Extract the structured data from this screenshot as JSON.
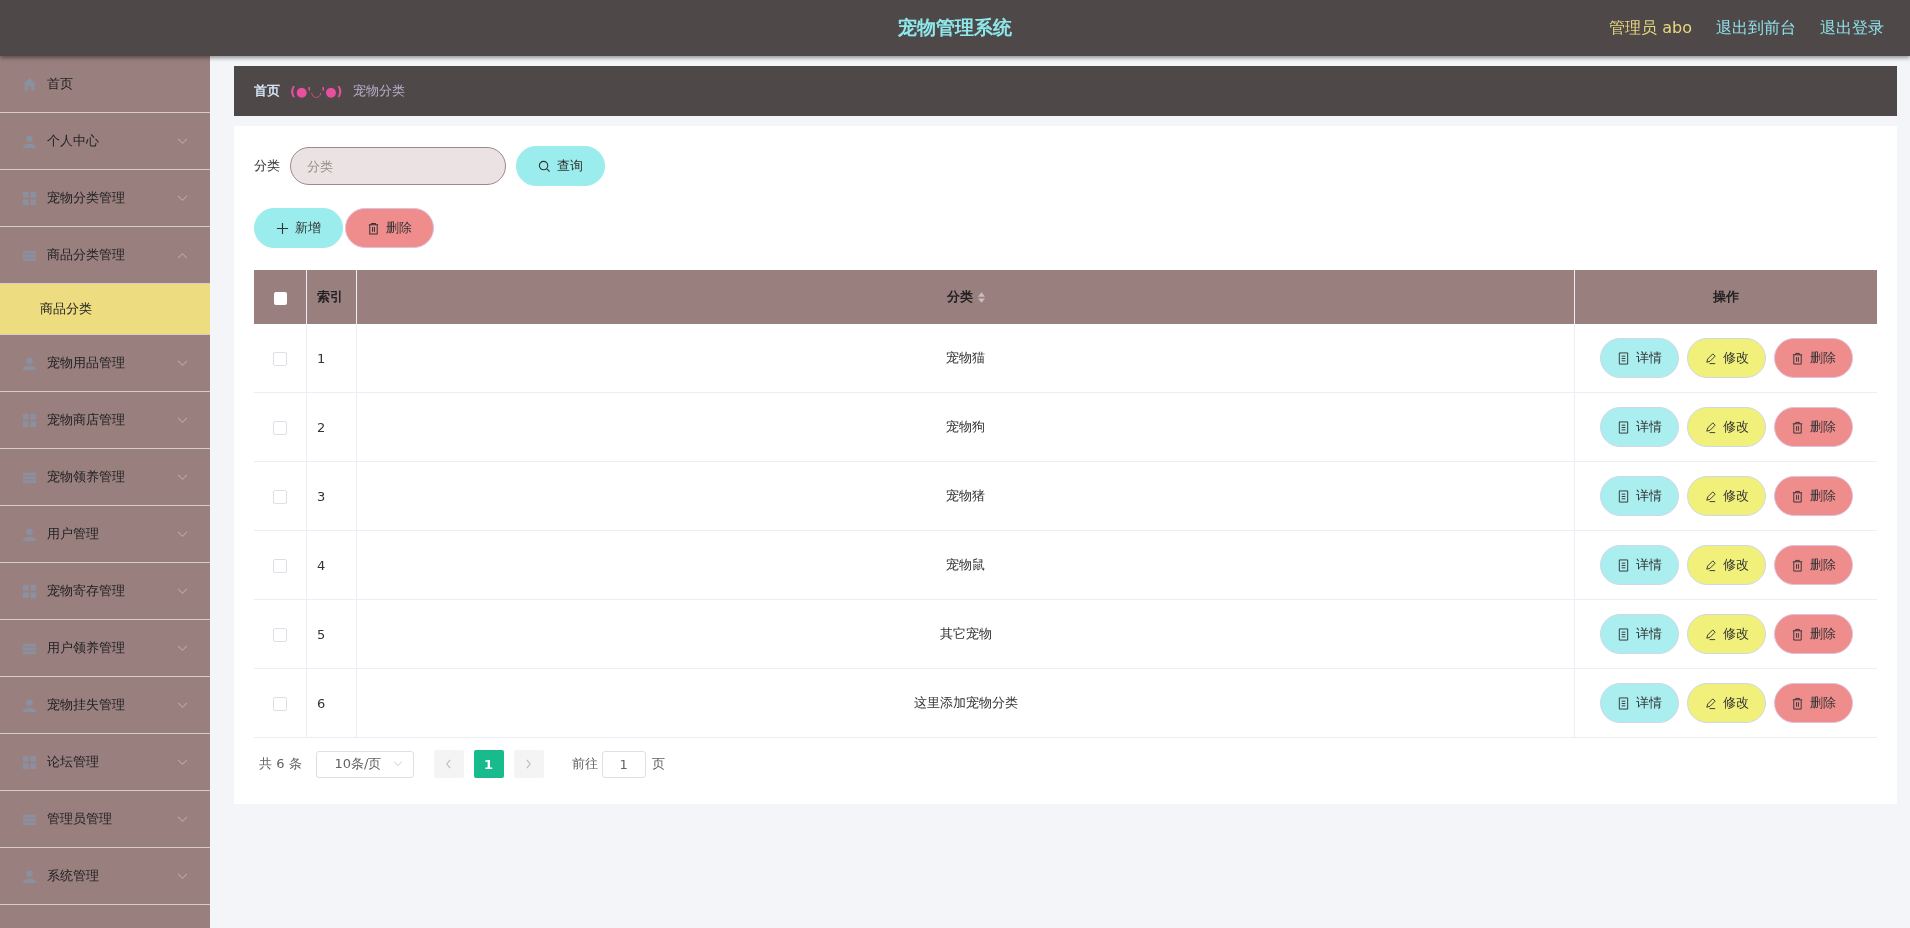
{
  "header": {
    "title": "宠物管理系统",
    "user": "管理员 abo",
    "links": [
      "退出到前台",
      "退出登录"
    ]
  },
  "sidebar": {
    "items": [
      {
        "label": "首页",
        "kind": "link"
      },
      {
        "label": "个人中心",
        "kind": "menu",
        "expanded": false
      },
      {
        "label": "宠物分类管理",
        "kind": "menu",
        "expanded": false
      },
      {
        "label": "商品分类管理",
        "kind": "menu",
        "expanded": true,
        "children": [
          {
            "label": "商品分类",
            "selected": true
          }
        ]
      },
      {
        "label": "宠物用品管理",
        "kind": "menu",
        "expanded": false
      },
      {
        "label": "宠物商店管理",
        "kind": "menu",
        "expanded": false
      },
      {
        "label": "宠物领养管理",
        "kind": "menu",
        "expanded": false
      },
      {
        "label": "用户管理",
        "kind": "menu",
        "expanded": false
      },
      {
        "label": "宠物寄存管理",
        "kind": "menu",
        "expanded": false
      },
      {
        "label": "用户领养管理",
        "kind": "menu",
        "expanded": false
      },
      {
        "label": "宠物挂失管理",
        "kind": "menu",
        "expanded": false
      },
      {
        "label": "论坛管理",
        "kind": "menu",
        "expanded": false
      },
      {
        "label": "管理员管理",
        "kind": "menu",
        "expanded": false
      },
      {
        "label": "系统管理",
        "kind": "menu",
        "expanded": false
      }
    ]
  },
  "breadcrumb": {
    "home": "首页",
    "separator": "(●'◡'●)",
    "current": "宠物分类"
  },
  "search": {
    "label": "分类",
    "placeholder": "分类",
    "button": "查询"
  },
  "toolbar": [
    {
      "label": "新增",
      "kind": "add"
    },
    {
      "label": "删除",
      "kind": "delete"
    }
  ],
  "table": {
    "all_checked": false,
    "columns": [
      {
        "label": "索引",
        "sortable": false
      },
      {
        "label": "分类",
        "sortable": true
      },
      {
        "label": "操作",
        "sortable": false
      }
    ],
    "rows": [
      {
        "checked": false,
        "index": "1",
        "category": "宠物猫",
        "actions": [
          {
            "label": "详情",
            "kind": "detail"
          },
          {
            "label": "修改",
            "kind": "edit"
          },
          {
            "label": "删除",
            "kind": "delete"
          }
        ]
      },
      {
        "checked": false,
        "index": "2",
        "category": "宠物狗",
        "actions": [
          {
            "label": "详情",
            "kind": "detail"
          },
          {
            "label": "修改",
            "kind": "edit"
          },
          {
            "label": "删除",
            "kind": "delete"
          }
        ]
      },
      {
        "checked": false,
        "index": "3",
        "category": "宠物猪",
        "actions": [
          {
            "label": "详情",
            "kind": "detail"
          },
          {
            "label": "修改",
            "kind": "edit"
          },
          {
            "label": "删除",
            "kind": "delete"
          }
        ]
      },
      {
        "checked": false,
        "index": "4",
        "category": "宠物鼠",
        "actions": [
          {
            "label": "详情",
            "kind": "detail"
          },
          {
            "label": "修改",
            "kind": "edit"
          },
          {
            "label": "删除",
            "kind": "delete"
          }
        ]
      },
      {
        "checked": false,
        "index": "5",
        "category": "其它宠物",
        "actions": [
          {
            "label": "详情",
            "kind": "detail"
          },
          {
            "label": "修改",
            "kind": "edit"
          },
          {
            "label": "删除",
            "kind": "delete"
          }
        ]
      },
      {
        "checked": false,
        "index": "6",
        "category": "这里添加宠物分类",
        "actions": [
          {
            "label": "详情",
            "kind": "detail"
          },
          {
            "label": "修改",
            "kind": "edit"
          },
          {
            "label": "删除",
            "kind": "delete"
          }
        ]
      }
    ]
  },
  "pagination": {
    "total": "共 6 条",
    "page_size": "10条/页",
    "pages": [
      {
        "label": "1",
        "selected": true
      }
    ],
    "goto_label": "前往",
    "goto_value": "1",
    "goto_suffix": "页"
  }
}
